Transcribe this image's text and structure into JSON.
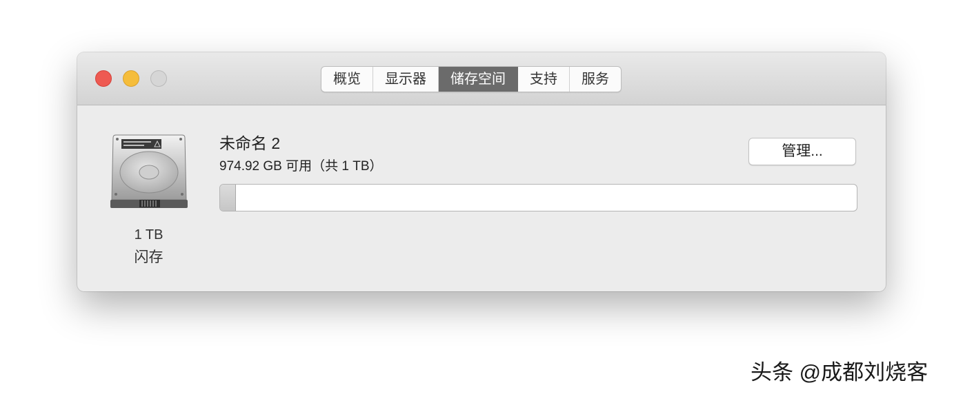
{
  "tabs": [
    {
      "label": "概览",
      "active": false
    },
    {
      "label": "显示器",
      "active": false
    },
    {
      "label": "储存空间",
      "active": true
    },
    {
      "label": "支持",
      "active": false
    },
    {
      "label": "服务",
      "active": false
    }
  ],
  "disk": {
    "capacity": "1 TB",
    "type": "闪存",
    "icon": "hard-drive-icon"
  },
  "volume": {
    "name": "未命名 2",
    "info": "974.92 GB 可用（共 1 TB）",
    "used_fraction": 0.025
  },
  "manage_button": "管理...",
  "watermark": "头条 @成都刘烧客",
  "colors": {
    "close": "#ee5a52",
    "minimize": "#f5bd3b",
    "zoom": "#d6d6d6",
    "active_tab": "#6b6b6b"
  }
}
